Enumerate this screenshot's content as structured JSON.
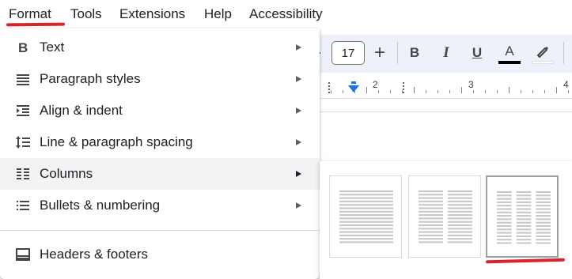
{
  "menubar": {
    "items": [
      "Format",
      "Tools",
      "Extensions",
      "Help",
      "Accessibility"
    ]
  },
  "toolbar": {
    "font_size": "17",
    "plus_label": "+",
    "bold_label": "B",
    "italic_label": "I",
    "underline_label": "U",
    "text_color_label": "A",
    "text_color": "#000000"
  },
  "ruler": {
    "numbers": [
      "2",
      "3",
      "4"
    ]
  },
  "format_menu": {
    "items": [
      {
        "label": "Text",
        "icon": "bold-icon",
        "submenu": true
      },
      {
        "label": "Paragraph styles",
        "icon": "paragraph-styles-icon",
        "submenu": true
      },
      {
        "label": "Align & indent",
        "icon": "indent-icon",
        "submenu": true
      },
      {
        "label": "Line & paragraph spacing",
        "icon": "line-spacing-icon",
        "submenu": true
      },
      {
        "label": "Columns",
        "icon": "columns-icon",
        "submenu": true,
        "highlighted": true
      },
      {
        "label": "Bullets & numbering",
        "icon": "bullets-icon",
        "submenu": true
      },
      {
        "label": "Headers & footers",
        "icon": "headers-footers-icon",
        "submenu": false
      }
    ]
  },
  "columns_submenu": {
    "options": [
      {
        "columns": 1
      },
      {
        "columns": 2
      },
      {
        "columns": 3,
        "selected": true
      }
    ]
  },
  "colors": {
    "accent": "#1a73e8",
    "annotation_red": "#d9232d",
    "toolbar_bg": "#edf2fa",
    "hover_bg": "#f1f3f4"
  }
}
